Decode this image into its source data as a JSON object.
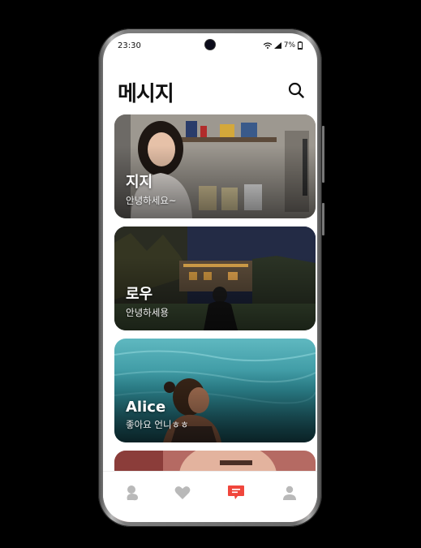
{
  "status_bar": {
    "time": "23:30",
    "battery": "7%",
    "icons": [
      "wifi-icon",
      "signal-icon",
      "battery-icon"
    ]
  },
  "header": {
    "title": "메시지",
    "search_icon": "search-icon"
  },
  "chats": [
    {
      "name": "지지",
      "last_message": "안녕하세요~"
    },
    {
      "name": "로우",
      "last_message": "안녕하세용"
    },
    {
      "name": "Alice",
      "last_message": "좋아요 언니ㅎㅎ"
    }
  ],
  "bottom_nav": {
    "items": [
      {
        "icon": "moments-icon",
        "active": false
      },
      {
        "icon": "heart-icon",
        "active": false
      },
      {
        "icon": "message-icon",
        "active": true
      },
      {
        "icon": "profile-icon",
        "active": false
      }
    ],
    "active_color": "#f0463c",
    "inactive_color": "#b9b9b9"
  }
}
